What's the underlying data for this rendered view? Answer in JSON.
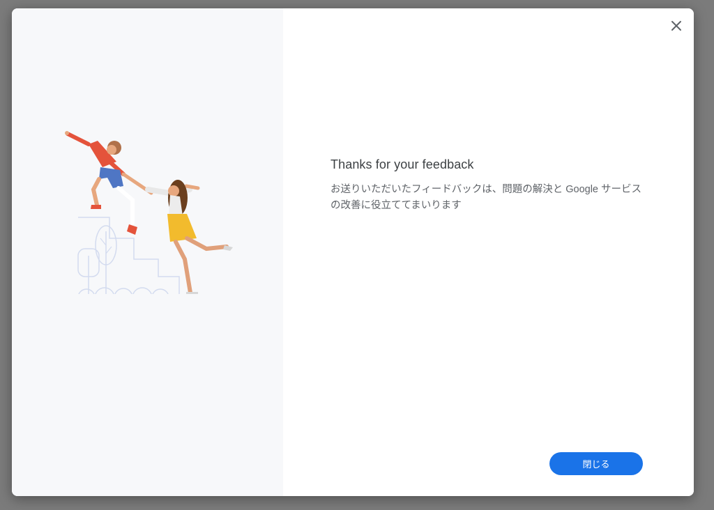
{
  "dialog": {
    "title": "Thanks for your feedback",
    "message": "お送りいただいたフィードバックは、問題の解決と Google サービスの改善に役立ててまいります",
    "close_icon": "close-icon",
    "primary_button_label": "閉じる",
    "illustration": "people-climbing-stairs-illustration"
  },
  "colors": {
    "overlay": "#7b7b7b",
    "left_panel": "#f7f8fa",
    "primary": "#1a73e8",
    "title_text": "#3c4043",
    "body_text": "#5f6368"
  }
}
